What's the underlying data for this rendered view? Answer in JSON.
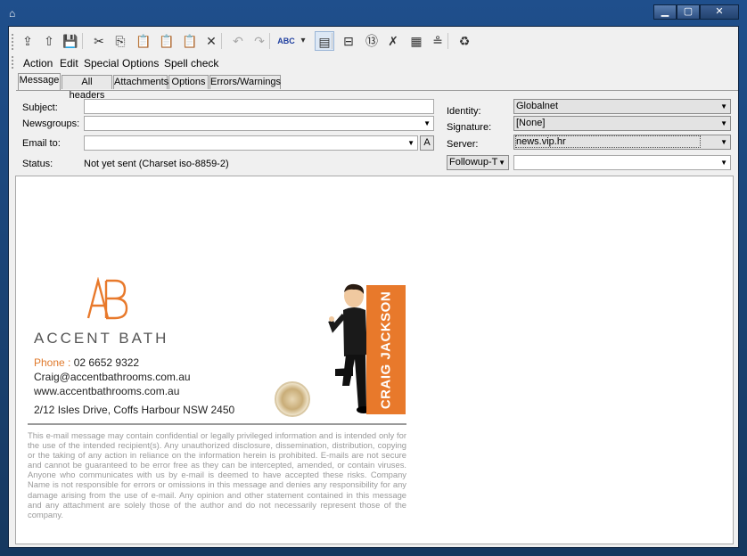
{
  "window": {
    "minimize": "▁",
    "maximize": "▢",
    "close": "✕"
  },
  "toolbar": {
    "buttons": [
      {
        "name": "send-now-icon",
        "glyph": "⇪"
      },
      {
        "name": "send-later-icon",
        "glyph": "⇧"
      },
      {
        "name": "save-draft-icon",
        "glyph": "💾"
      },
      {
        "name": "cut-icon",
        "glyph": "✂"
      },
      {
        "name": "copy-icon",
        "glyph": "⎘"
      },
      {
        "name": "paste-icon",
        "glyph": "📋"
      },
      {
        "name": "paste-quote-icon",
        "glyph": "📋"
      },
      {
        "name": "paste-special-icon",
        "glyph": "📋"
      },
      {
        "name": "delete-icon",
        "glyph": "✕"
      },
      {
        "name": "undo-icon",
        "glyph": "↶"
      },
      {
        "name": "redo-icon",
        "glyph": "↷"
      },
      {
        "name": "spell-check-icon",
        "glyph": "ABC"
      },
      {
        "name": "spell-dropdown-icon",
        "glyph": "▾"
      },
      {
        "name": "html-mode-icon",
        "glyph": "▤"
      },
      {
        "name": "insert-file-icon",
        "glyph": "⊟"
      },
      {
        "name": "wrap-icon",
        "glyph": "⑬"
      },
      {
        "name": "rot13-icon",
        "glyph": "✗"
      },
      {
        "name": "properties-icon",
        "glyph": "▦"
      },
      {
        "name": "signature-icon",
        "glyph": "≗"
      },
      {
        "name": "address-book-icon",
        "glyph": "♻"
      }
    ]
  },
  "menu": {
    "items": [
      "Action",
      "Edit",
      "Special",
      "Options",
      "Spell check"
    ]
  },
  "tabs": {
    "items": [
      "Message",
      "All headers",
      "Attachments",
      "Options",
      "Errors/Warnings"
    ]
  },
  "form": {
    "subject_label": "Subject:",
    "subject_value": "",
    "newsgroups_label": "Newsgroups:",
    "newsgroups_value": "",
    "emailto_label": "Email to:",
    "emailto_value": "",
    "a_button": "A",
    "status_label": "Status:",
    "status_value": "Not yet sent (Charset iso-8859-2)",
    "identity_label": "Identity:",
    "identity_value": "Globalnet",
    "signature_label": "Signature:",
    "signature_value": "[None]",
    "server_label": "Server:",
    "server_value": "news.vip.hr",
    "followup_value": "Followup-T",
    "followup_field_value": ""
  },
  "signature": {
    "brand": "ACCENT BATH",
    "phone_label": "Phone : ",
    "phone": "02 6652 9322",
    "email": "Craig@accentbathrooms.com.au",
    "website": "www.accentbathrooms.com.au",
    "address": "2/12 Isles Drive, Coffs Harbour NSW 2450",
    "name_banner": "CRAIG JACKSON",
    "disclaimer": "This e-mail message may contain confidential or legally privileged information and is intended only for the use of the intended recipient(s). Any unauthorized disclosure, dissemination, distribution, copying or the taking of any action in reliance on the information herein is prohibited. E-mails are not secure and cannot be guaranteed to be error free as they can be intercepted, amended, or contain viruses. Anyone who communicates with us by e-mail is deemed to have accepted these risks. Company Name is not responsible for errors or omissions in this message and denies any responsibility for any damage arising from the use of e-mail. Any opinion and other statement contained in this message and any attachment are solely those of the author and do not necessarily represent those of the company."
  },
  "colors": {
    "brand_orange": "#e8792b",
    "titlebar": "#1f4f8c"
  }
}
